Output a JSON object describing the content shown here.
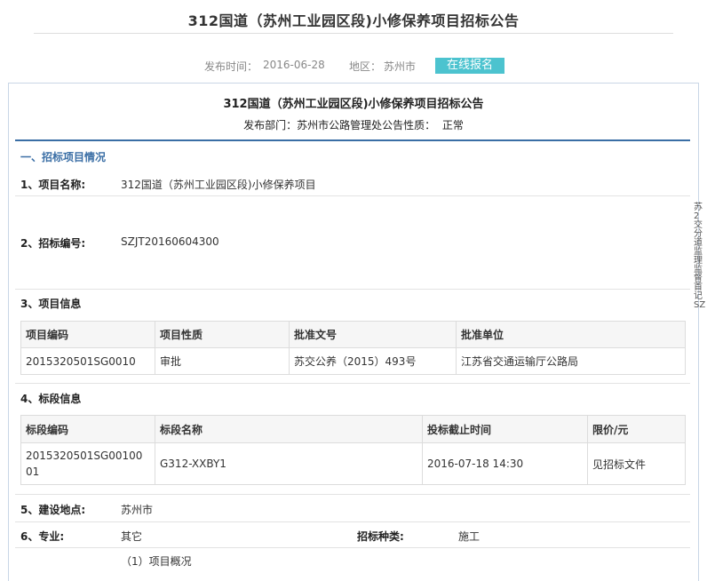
{
  "page": {
    "title": "312国道（苏州工业园区段)小修保养项目招标公告",
    "publish_time_label": "发布时间：",
    "publish_time": "2016-06-28",
    "region_label": "地区：",
    "region": "苏州市",
    "signup_button": "在线报名"
  },
  "notice": {
    "title": "312国道（苏州工业园区段)小修保养项目招标公告",
    "dept_label": "发布部门：",
    "dept": "苏州市公路管理处",
    "nature_label": "公告性质：",
    "nature": "正常"
  },
  "section1": {
    "heading": "一、招标项目情况",
    "project_name_label": "1、项目名称:",
    "project_name": "312国道（苏州工业园区段)小修保养项目",
    "bid_no_label": "2、招标编号:",
    "bid_no": "SZJT20160604300",
    "project_info_label": "3、项目信息",
    "project_table": {
      "headers": [
        "项目编码",
        "项目性质",
        "批准文号",
        "批准单位"
      ],
      "row": [
        "2015320501SG0010",
        "审批",
        "苏交公养（2015）493号",
        "江苏省交通运输厅公路局"
      ]
    },
    "section_info_label": "4、标段信息",
    "section_table": {
      "headers": [
        "标段编码",
        "标段名称",
        "投标截止时间",
        "限价/元"
      ],
      "row_code_line1": "2015320501SG00100",
      "row_code_line2": "01",
      "row": [
        "G312-XXBY1",
        "2016-07-18 14:30",
        "见招标文件"
      ]
    },
    "location_label": "5、建设地点:",
    "location": "苏州市",
    "major_label": "6、专业:",
    "major": "其它",
    "bid_type_label": "招标种类:",
    "bid_type": "施工",
    "overview_label": "（1）项目概况"
  },
  "side_text": "苏2交分道监理监督首记SZ"
}
